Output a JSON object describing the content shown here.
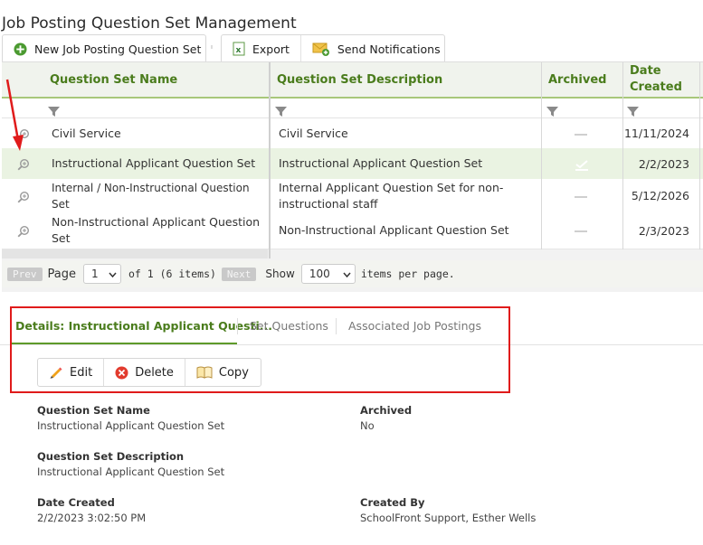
{
  "page": {
    "title": "Job Posting Question Set Management"
  },
  "toolbar": {
    "new_label": "New Job Posting Question Set",
    "export_label": "Export",
    "notify_label": "Send Notifications"
  },
  "grid": {
    "columns": {
      "name": "Question Set Name",
      "description": "Question Set Description",
      "archived": "Archived",
      "date_line1": "Date",
      "date_line2": "Created"
    },
    "rows": [
      {
        "name": "Civil Service",
        "description": "Civil Service",
        "archived": false,
        "date": "11/11/2024"
      },
      {
        "name": "Instructional Applicant Question Set",
        "description": "Instructional Applicant Question Set",
        "archived": true,
        "date": "2/2/2023"
      },
      {
        "name": "Internal / Non-Instructional Question Set",
        "description": "Internal Applicant Question Set for non-instructional staff",
        "archived": false,
        "date": "5/12/2026"
      },
      {
        "name": "Non-Instructional Applicant Question Set",
        "description": "Non-Instructional Applicant Question Set",
        "archived": false,
        "date": "2/3/2023"
      }
    ]
  },
  "pager": {
    "prev": "Prev",
    "page_label": "Page",
    "page_value": "1",
    "of_text": "of 1 (6 items)",
    "next": "Next",
    "show_label": "Show",
    "per_page_value": "100",
    "per_page_suffix": "items per page."
  },
  "tabs": {
    "details": "Details: Instructional Applicant Questi...",
    "set_questions": "Set Questions",
    "associated": "Associated Job Postings"
  },
  "actions": {
    "edit": "Edit",
    "delete": "Delete",
    "copy": "Copy"
  },
  "details": {
    "name_label": "Question Set Name",
    "name_value": "Instructional Applicant Question Set",
    "archived_label": "Archived",
    "archived_value": "No",
    "desc_label": "Question Set Description",
    "desc_value": "Instructional Applicant Question Set",
    "date_label": "Date Created",
    "date_value": "2/2/2023 3:02:50 PM",
    "created_by_label": "Created By",
    "created_by_value": "SchoolFront Support, Esther Wells"
  },
  "colors": {
    "accent_green": "#4a7c1c",
    "selected_row": "#eaf3e2",
    "annotation_red": "#e01b1b"
  },
  "icons": [
    "plus-circle-icon",
    "excel-icon",
    "envelope-plus-icon",
    "funnel-icon",
    "zoom-icon",
    "check-icon",
    "pencil-icon",
    "delete-x-icon",
    "book-icon",
    "chevron-down-icon",
    "arrow-annotation"
  ]
}
